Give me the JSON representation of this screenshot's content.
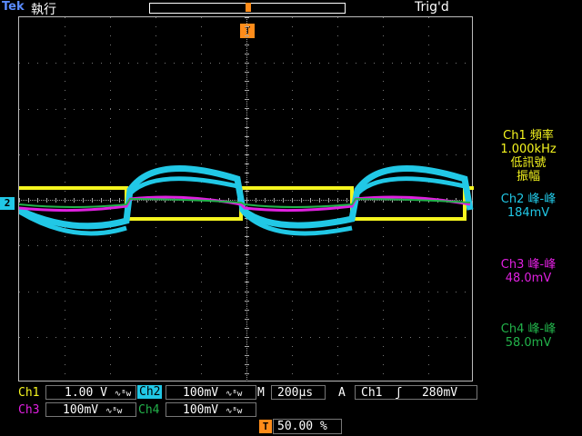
{
  "top": {
    "brand": "Tek",
    "run_status": "執行",
    "trigger_status": "Trig'd",
    "trigger_marker": "T"
  },
  "readouts": {
    "ch1": {
      "title": "Ch1 頻率",
      "value": "1.000kHz",
      "note1": "低訊號",
      "note2": "振幅"
    },
    "ch2": {
      "title": "Ch2 峰-峰",
      "value": "184mV"
    },
    "ch3": {
      "title": "Ch3 峰-峰",
      "value": "48.0mV"
    },
    "ch4": {
      "title": "Ch4 峰-峰",
      "value": "58.0mV"
    }
  },
  "bottom": {
    "ch1_label": "Ch1",
    "ch1_scale": "1.00 V",
    "ch2_label": "Ch2",
    "ch2_scale": "100mV",
    "ch3_label": "Ch3",
    "ch3_scale": "100mV",
    "ch4_label": "Ch4",
    "ch4_scale": "100mV",
    "bw_symbol": "∿ᴮw",
    "timebase_label": "M",
    "timebase": "200µs",
    "acq_mode": "A",
    "trig_source": "Ch1",
    "trig_slope": "ʃ",
    "trig_level": "280mV",
    "trig_pos_marker": "T",
    "trig_position": "50.00 %"
  },
  "markers": {
    "ch2_marker": "2"
  },
  "colors": {
    "ch1": "#f5f51f",
    "ch2": "#21c8e6",
    "ch3": "#e020e0",
    "ch4": "#22b24a",
    "trigger": "#ff8c1a"
  }
}
